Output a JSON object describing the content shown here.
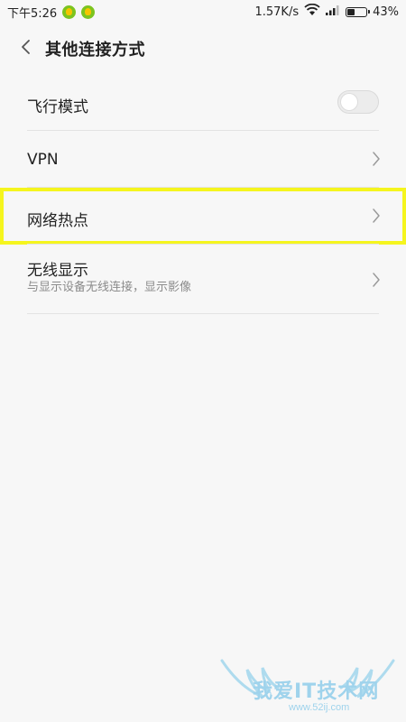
{
  "status_bar": {
    "time": "下午5:26",
    "network_speed": "1.57K/s",
    "battery_percent": "43%",
    "battery_level": 0.43
  },
  "header": {
    "back_icon": "chevron-left-icon",
    "title": "其他连接方式"
  },
  "settings": {
    "airplane_mode": {
      "label": "飞行模式",
      "enabled": false
    },
    "vpn": {
      "label": "VPN"
    },
    "hotspot": {
      "label": "网络热点"
    },
    "wireless_display": {
      "label": "无线显示",
      "description": "与显示设备无线连接，显示影像"
    }
  },
  "highlight_color": "#f5f51e",
  "watermark": {
    "text": "我爱IT技术网",
    "url": "www.52ij.com"
  }
}
